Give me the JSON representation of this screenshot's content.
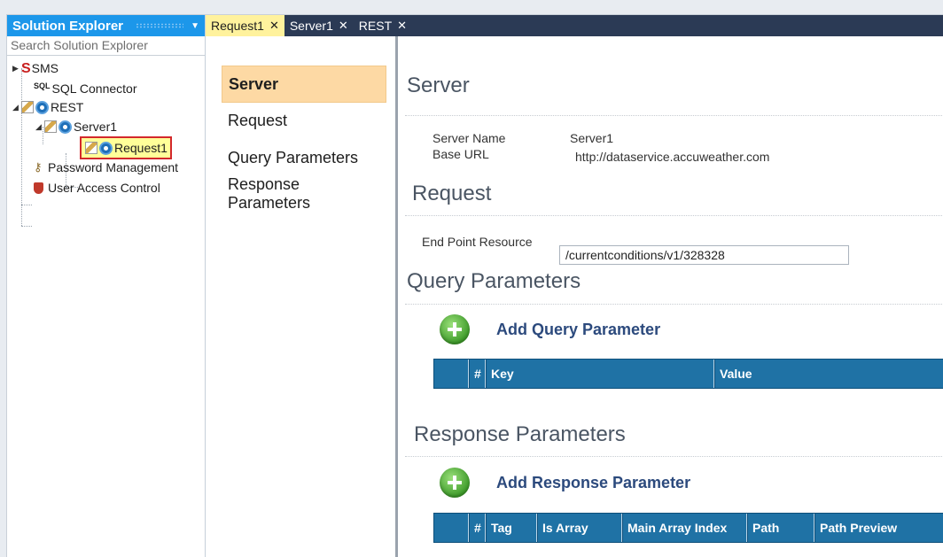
{
  "solution_explorer": {
    "title": "Solution Explorer",
    "search_placeholder": "Search Solution Explorer",
    "items": {
      "sms": "SMS",
      "sql": "SQL Connector",
      "rest": "REST",
      "server1": "Server1",
      "request1": "Request1",
      "password": "Password Management",
      "uac": "User Access Control"
    },
    "icon_sql_text": "SQL"
  },
  "tabs": [
    {
      "label": "Request1",
      "close": "✕"
    },
    {
      "label": "Server1",
      "close": "✕"
    },
    {
      "label": "REST",
      "close": "✕"
    }
  ],
  "nav": {
    "items": [
      "Server",
      "Request",
      "Query Parameters",
      "Response Parameters"
    ],
    "active": "Server"
  },
  "server": {
    "heading": "Server",
    "server_name_label": "Server Name",
    "server_name_value": "Server1",
    "base_url_label": "Base URL",
    "base_url_value": "http://dataservice.accuweather.com"
  },
  "request": {
    "heading": "Request",
    "endpoint_label": "End Point Resource",
    "endpoint_value": "/currentconditions/v1/328328"
  },
  "query": {
    "heading": "Query Parameters",
    "add_label": "Add Query Parameter",
    "columns": [
      "",
      "#",
      "Key",
      "Value"
    ]
  },
  "response": {
    "heading": "Response Parameters",
    "add_label": "Add Response Parameter",
    "columns": [
      "",
      "#",
      "Tag",
      "Is Array",
      "Main Array Index",
      "Path",
      "Path Preview"
    ]
  },
  "colors": {
    "se_header": "#1c97ea",
    "tabbar": "#2b3a55",
    "active_tab": "#fff29d",
    "nav_active": "#fdd9a4",
    "grid_header": "#1f72a5",
    "selection_border": "#d3282b"
  }
}
